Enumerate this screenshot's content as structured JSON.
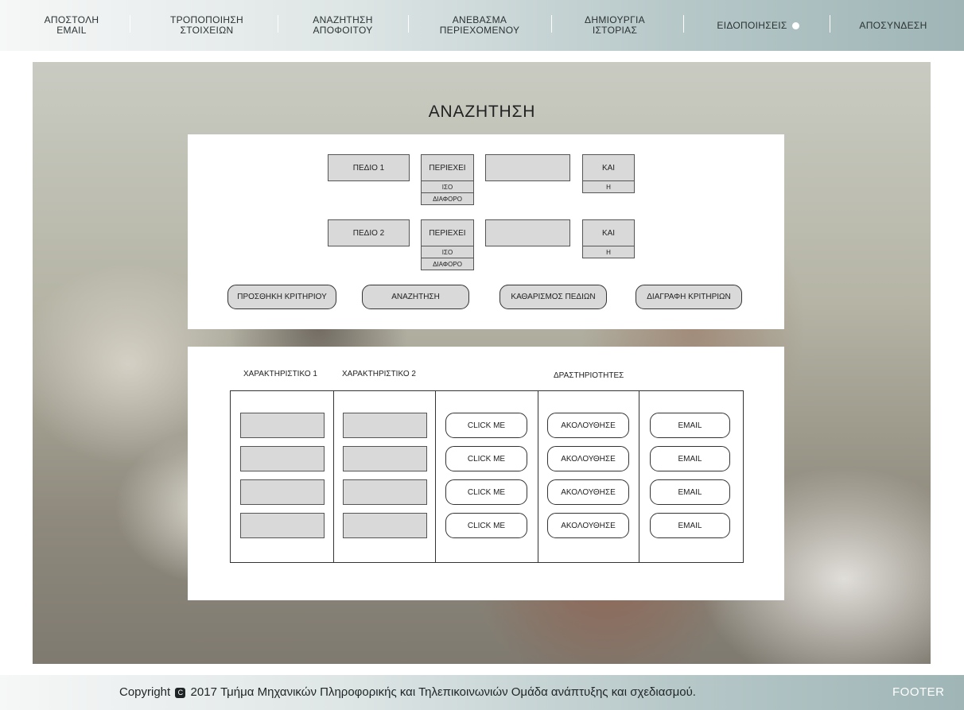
{
  "nav": {
    "items": [
      {
        "line1": "ΑΠΟΣΤΟΛΗ",
        "line2": "EMAIL"
      },
      {
        "line1": "ΤΡΟΠΟΠΟΙΗΣΗ",
        "line2": "ΣΤΟΙΧΕΙΩΝ"
      },
      {
        "line1": "ΑΝΑΖΗΤΗΣΗ",
        "line2": "ΑΠΟΦΟΙΤΟΥ"
      },
      {
        "line1": "ΑΝΕΒΑΣΜΑ",
        "line2": "ΠΕΡΙΕΧΟΜΕΝΟΥ"
      },
      {
        "line1": "ΔΗΜΙΟΥΡΓΙΑ",
        "line2": "ΙΣΤΟΡΙΑΣ"
      },
      {
        "line1": "ΕΙΔΟΠΟΙΗΣΕΙΣ",
        "line2": ""
      },
      {
        "line1": "ΑΠΟΣΥΝΔΕΣΗ",
        "line2": ""
      }
    ]
  },
  "page_title": "ΑΝΑΖΗΤΗΣΗ",
  "criteria": [
    {
      "field_label": "ΠΕΔΙΟ 1",
      "operator_selected": "ΠΕΡΙΕΧΕΙ",
      "operator_options": [
        "ΙΣΟ",
        "ΔΙΑΦΟΡΟ"
      ],
      "value": "",
      "logic_selected": "ΚΑΙ",
      "logic_options": [
        "Η"
      ]
    },
    {
      "field_label": "ΠΕΔΙΟ 2",
      "operator_selected": "ΠΕΡΙΕΧΕΙ",
      "operator_options": [
        "ΙΣΟ",
        "ΔΙΑΦΟΡΟ"
      ],
      "value": "",
      "logic_selected": "ΚΑΙ",
      "logic_options": [
        "Η"
      ]
    }
  ],
  "actions": {
    "add_criterion": "ΠΡΟΣΘΗΚΗ ΚΡΙΤΗΡΙΟΥ",
    "search": "ΑΝΑΖΗΤΗΣΗ",
    "clear_fields": "ΚΑΘΑΡΙΣΜΟΣ ΠΕΔΙΩΝ",
    "delete_criteria": "ΔΙΑΓΡΑΦΗ ΚΡΙΤΗΡΙΩΝ"
  },
  "results": {
    "headers": [
      "ΧΑΡΑΚΤΗΡΙΣΤΙΚΟ 1",
      "ΧΑΡΑΚΤΗΡΙΣΤΙΚΟ 2",
      "ΔΡΑΣΤΗΡΙΟΤΗΤΕΣ"
    ],
    "rows": [
      {
        "attr1": "",
        "attr2": "",
        "click": "CLICK ME",
        "follow": "ΑΚΟΛΟΥΘΗΣΕ",
        "email": "EMAIL"
      },
      {
        "attr1": "",
        "attr2": "",
        "click": "CLICK ME",
        "follow": "ΑΚΟΛΟΥΘΗΣΕ",
        "email": "EMAIL"
      },
      {
        "attr1": "",
        "attr2": "",
        "click": "CLICK ME",
        "follow": "ΑΚΟΛΟΥΘΗΣΕ",
        "email": "EMAIL"
      },
      {
        "attr1": "",
        "attr2": "",
        "click": "CLICK ME",
        "follow": "ΑΚΟΛΟΥΘΗΣΕ",
        "email": "EMAIL"
      }
    ]
  },
  "footer": {
    "copyright_prefix": "Copyright",
    "copyright_icon": "C",
    "copyright_text": "2017 Τμήμα Μηχανικών Πληροφορικής και Τηλεπικοινωνιών Ομάδα ανάπτυξης και σχεδιασμού.",
    "label": "FOOTER"
  },
  "colors": {
    "nav_gradient_start": "#f6f7f7",
    "nav_gradient_end": "#9fb5b6",
    "field_gray": "#d9d9d9",
    "notification_dot": "#ffffff"
  }
}
